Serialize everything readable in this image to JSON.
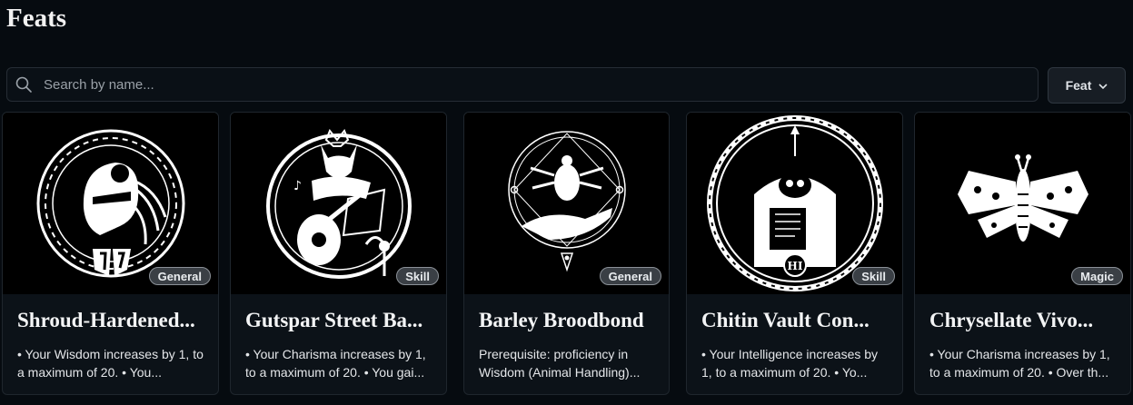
{
  "page": {
    "title": "Feats"
  },
  "search": {
    "placeholder": "Search by name...",
    "icon": "search-icon"
  },
  "filter": {
    "label": "Feat",
    "icon": "chevron-down-icon"
  },
  "colors": {
    "background": "#060b10",
    "card": "#0c1218",
    "badge": "#3a3f45"
  },
  "cards": [
    {
      "name": "Shroud-Hardened...",
      "badge": "General",
      "description": "• Your Wisdom increases by 1, to a maximum of 20. • You...",
      "icon": "armored-head-emblem-icon"
    },
    {
      "name": "Gutspar Street Ba...",
      "badge": "Skill",
      "description": "• Your Charisma increases by 1, to a maximum of 20. • You gai...",
      "icon": "fox-lute-emblem-icon"
    },
    {
      "name": "Barley Broodbond",
      "badge": "General",
      "description": "Prerequisite: proficiency in Wisdom (Animal Handling)...",
      "icon": "beetle-hand-emblem-icon"
    },
    {
      "name": "Chitin Vault Con...",
      "badge": "Skill",
      "description": "• Your Intelligence increases by 1, to a maximum of 20. • Yo...",
      "icon": "beetle-vault-emblem-icon"
    },
    {
      "name": "Chrysellate Vivo...",
      "badge": "Magic",
      "description": "• Your Charisma increases by 1, to a maximum of 20. • Over th...",
      "icon": "moth-icon"
    }
  ]
}
